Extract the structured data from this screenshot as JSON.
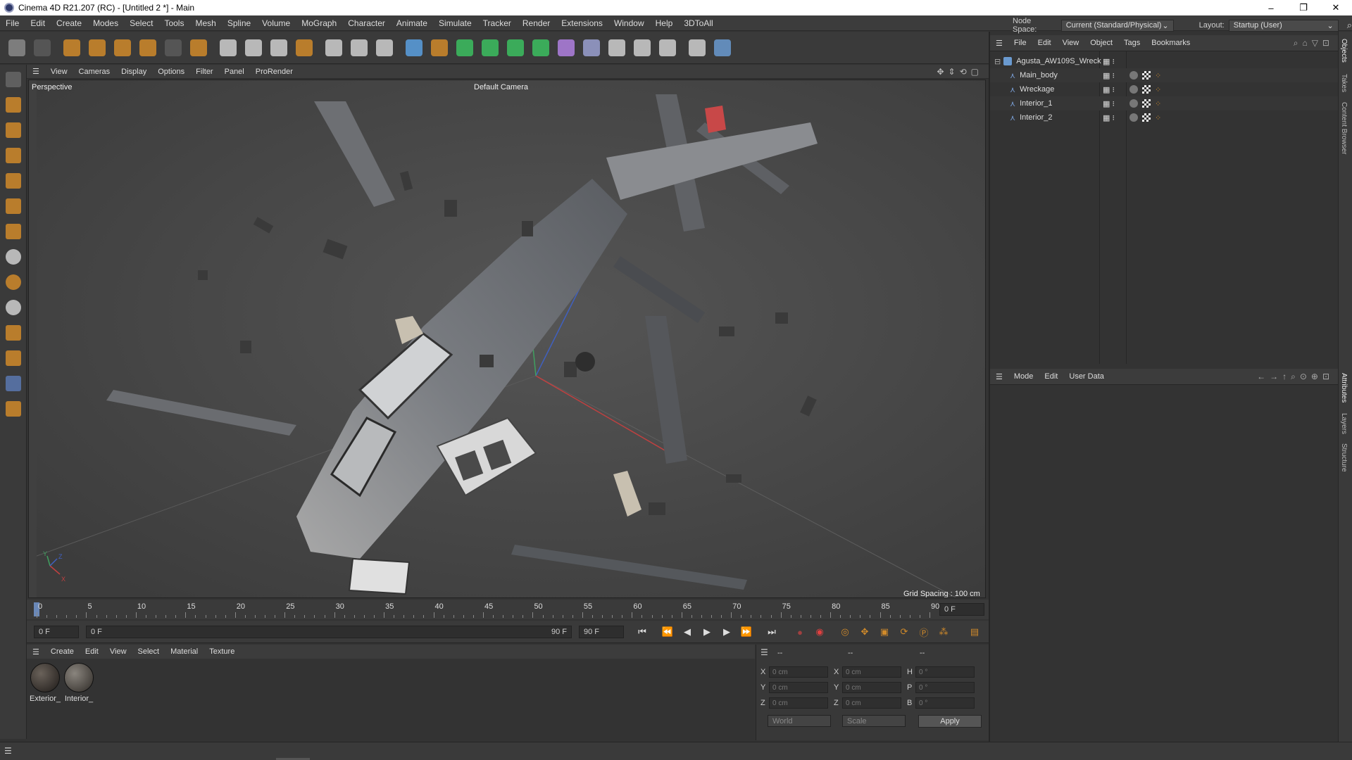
{
  "window": {
    "title": "Cinema 4D R21.207 (RC) - [Untitled 2 *] - Main",
    "controls": [
      "–",
      "❐",
      "✕"
    ]
  },
  "menubar": {
    "items": [
      "File",
      "Edit",
      "Create",
      "Modes",
      "Select",
      "Tools",
      "Mesh",
      "Spline",
      "Volume",
      "MoGraph",
      "Character",
      "Animate",
      "Simulate",
      "Tracker",
      "Render",
      "Extensions",
      "Window",
      "Help",
      "3DToAll"
    ],
    "node_space_label": "Node Space:",
    "node_space_value": "Current (Standard/Physical)",
    "layout_label": "Layout:",
    "layout_value": "Startup (User)"
  },
  "toolbar": {
    "buttons": [
      {
        "name": "undo-icon",
        "color": "#8a8a8a"
      },
      {
        "name": "redo-icon",
        "color": "#5a5a5a"
      },
      {
        "name": "select-icon",
        "color": "#d08a2a"
      },
      {
        "name": "move-icon",
        "color": "#d08a2a"
      },
      {
        "name": "scale-icon",
        "color": "#d08a2a"
      },
      {
        "name": "rotate-icon",
        "color": "#d08a2a"
      },
      {
        "name": "live-select-icon",
        "color": "#5a5a5a"
      },
      {
        "name": "add-axis-icon",
        "color": "#d08a2a"
      },
      {
        "name": "x-axis-icon",
        "color": "#cfcfcf"
      },
      {
        "name": "y-axis-icon",
        "color": "#cfcfcf"
      },
      {
        "name": "z-axis-icon",
        "color": "#cfcfcf"
      },
      {
        "name": "coordinate-system-icon",
        "color": "#d08a2a"
      },
      {
        "name": "render-region-icon",
        "color": "#cfcfcf"
      },
      {
        "name": "render-view-icon",
        "color": "#cfcfcf"
      },
      {
        "name": "render-settings-icon",
        "color": "#cfcfcf"
      },
      {
        "name": "cube-icon",
        "color": "#5aa0e0"
      },
      {
        "name": "pen-icon",
        "color": "#d08a2a"
      },
      {
        "name": "subdivision-icon",
        "color": "#3cc060"
      },
      {
        "name": "extrude-icon",
        "color": "#3cc060"
      },
      {
        "name": "cloner-icon",
        "color": "#3cc060"
      },
      {
        "name": "voronoi-icon",
        "color": "#3cc060"
      },
      {
        "name": "bend-icon",
        "color": "#b080e0"
      },
      {
        "name": "floor-icon",
        "color": "#9aa0d0"
      },
      {
        "name": "scene-icon",
        "color": "#cfcfcf"
      },
      {
        "name": "camera-icon",
        "color": "#cfcfcf"
      },
      {
        "name": "light-icon",
        "color": "#cfcfcf"
      },
      {
        "name": "3dtoall-icon",
        "color": "#cfcfcf"
      },
      {
        "name": "python-icon",
        "color": "#6a9ad0"
      }
    ]
  },
  "left_tools": [
    "make-editable-icon",
    "model-mode-icon",
    "texture-mode-icon",
    "point-mode-icon",
    "edge-mode-icon",
    "polygon-mode-icon",
    "axis-mode-icon",
    "snap-icon",
    "snap-settings-icon",
    "snap-workplane-icon",
    "magnet-icon",
    "workplane-icon",
    "lock-workplane-icon",
    "soft-selection-icon"
  ],
  "viewport": {
    "menu": [
      "View",
      "Cameras",
      "Display",
      "Options",
      "Filter",
      "Panel",
      "ProRender"
    ],
    "projection": "Perspective",
    "camera": "Default Camera",
    "grid_spacing": "Grid Spacing : 100 cm"
  },
  "timeline": {
    "ticks": [
      "0",
      "5",
      "10",
      "15",
      "20",
      "25",
      "30",
      "35",
      "40",
      "45",
      "50",
      "55",
      "60",
      "65",
      "70",
      "75",
      "80",
      "85",
      "90"
    ],
    "current_frame": "0 F",
    "start_field": "0 F",
    "range_start": "0 F",
    "range_end": "90 F",
    "end_field": "90 F"
  },
  "material_manager": {
    "menu": [
      "Create",
      "Edit",
      "View",
      "Select",
      "Material",
      "Texture"
    ],
    "materials": [
      {
        "label": "Exterior_",
        "color": "#3a3430"
      },
      {
        "label": "Interior_",
        "color": "#5a5550"
      }
    ]
  },
  "coordinates": {
    "headers": [
      "--",
      "--",
      "--"
    ],
    "rows": [
      {
        "a": "X",
        "av": "0 cm",
        "b": "X",
        "bv": "0 cm",
        "c": "H",
        "cv": "0 °"
      },
      {
        "a": "Y",
        "av": "0 cm",
        "b": "Y",
        "bv": "0 cm",
        "c": "P",
        "cv": "0 °"
      },
      {
        "a": "Z",
        "av": "0 cm",
        "b": "Z",
        "bv": "0 cm",
        "c": "B",
        "cv": "0 °"
      }
    ],
    "world": "World",
    "scale": "Scale",
    "apply": "Apply"
  },
  "object_manager": {
    "menu": [
      "File",
      "Edit",
      "View",
      "Object",
      "Tags",
      "Bookmarks"
    ],
    "root": "Agusta_AW109S_Wreck",
    "children": [
      "Main_body",
      "Wreckage",
      "Interior_1",
      "Interior_2"
    ]
  },
  "attributes": {
    "menu": [
      "Mode",
      "Edit",
      "User Data"
    ]
  },
  "side_tabs": [
    "Objects",
    "Takes",
    "Content Browser",
    "Attributes",
    "Layers",
    "Structure"
  ]
}
